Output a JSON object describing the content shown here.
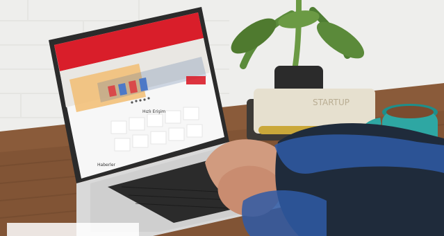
{
  "site": {
    "nav": [
      "",
      "",
      "",
      "",
      "",
      ""
    ],
    "quick_title": "Hızlı Erişim",
    "footer_label": "Haberler",
    "banner_badge": ""
  },
  "colors": {
    "wall": "#ededed",
    "desk": "#8a5b3a",
    "laptop": "#2b2b2b",
    "site_red": "#d91e2a",
    "mug": "#2ea7a3"
  }
}
